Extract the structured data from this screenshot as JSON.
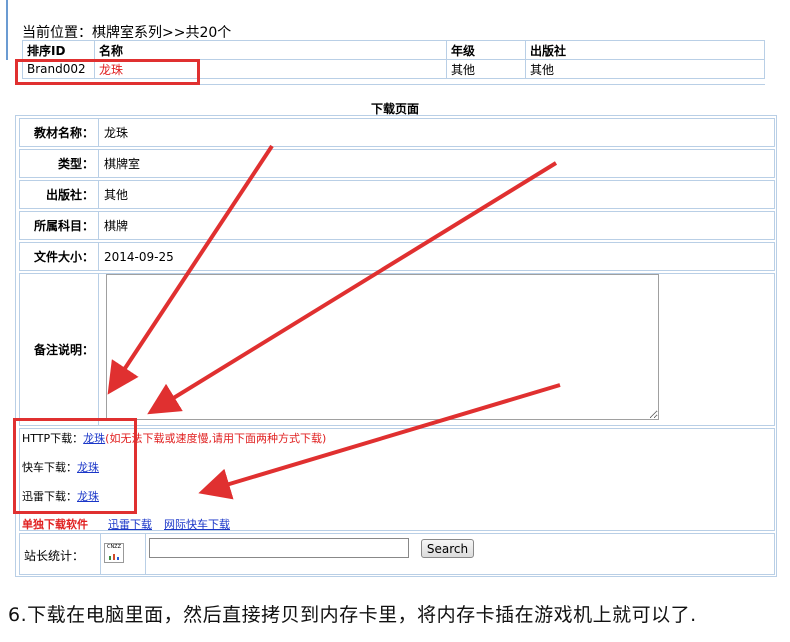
{
  "breadcrumb": "当前位置：棋牌室系列>>共20个",
  "list": {
    "headers": [
      "排序ID",
      "名称",
      "年级",
      "出版社"
    ],
    "rows": [
      [
        "Brand002",
        "龙珠",
        "其他",
        "其他"
      ]
    ]
  },
  "download_page": {
    "title": "下载页面",
    "fields": [
      {
        "label": "教材名称：",
        "value": "龙珠"
      },
      {
        "label": "类型：",
        "value": "棋牌室"
      },
      {
        "label": "出版社：",
        "value": "其他"
      },
      {
        "label": "所属科目：",
        "value": "棋牌"
      },
      {
        "label": "文件大小：",
        "value": "2014-09-25"
      }
    ],
    "note_label": "备注说明：",
    "note_value": "",
    "http_label": "HTTP下载：",
    "http_link": "龙珠",
    "http_warning": "(如无法下载或速度慢,请用下面两种方式下载)",
    "kuaiche_label": "快车下载：",
    "kuaiche_link": "龙珠",
    "xunlei_label": "迅雷下载：",
    "xunlei_link": "龙珠",
    "software_label": "单独下载软件",
    "software_links": [
      "迅雷下载",
      "网际快车下载"
    ],
    "stats_label": "站长统计：",
    "stats_icon_text": "CNZZ",
    "search_value": "",
    "search_button": "Search"
  },
  "caption": "6.下载在电脑里面，然后直接拷贝到内存卡里，将内存卡插在游戏机上就可以了.",
  "colors": {
    "annotation_red": "#e03030",
    "link_blue": "#1a36c8",
    "border": "#b9cfe6"
  }
}
